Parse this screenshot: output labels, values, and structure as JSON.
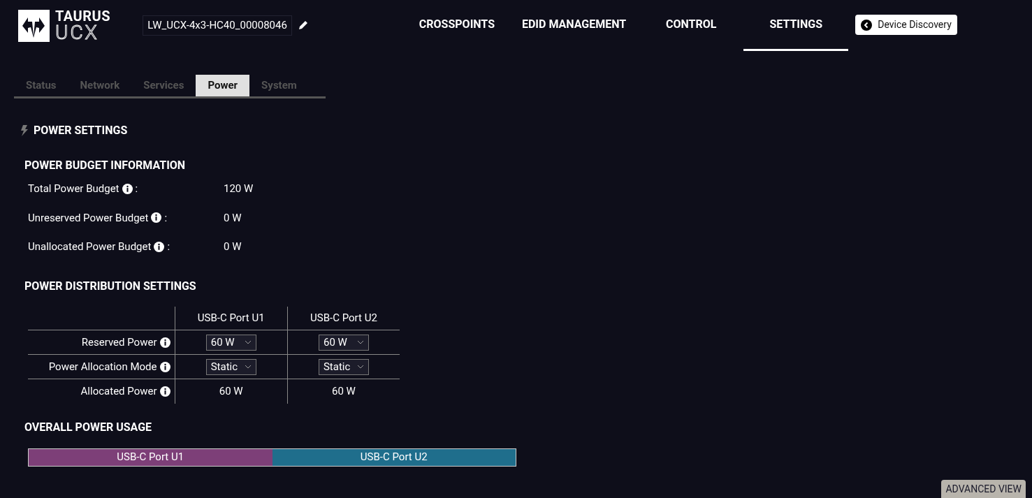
{
  "logo": {
    "line_1": "TAURUS",
    "line_2": "UCX"
  },
  "device_name": "LW_UCX-4x3-HC40_00008046",
  "nav": [
    {
      "label": "CROSSPOINTS",
      "selected": false
    },
    {
      "label": "EDID MANAGEMENT",
      "selected": false
    },
    {
      "label": "CONTROL",
      "selected": false
    },
    {
      "label": "SETTINGS",
      "selected": true
    }
  ],
  "device_discovery_button": "Device Discovery",
  "tabs": [
    {
      "label": "Status",
      "selected": false
    },
    {
      "label": "Network",
      "selected": false
    },
    {
      "label": "Services",
      "selected": false
    },
    {
      "label": "Power",
      "selected": true
    },
    {
      "label": "System",
      "selected": false
    }
  ],
  "section_title": "POWER SETTINGS",
  "budget": {
    "title": "POWER BUDGET INFORMATION",
    "rows": [
      {
        "label": "Total Power Budget",
        "suffix": ":",
        "value": "120 W"
      },
      {
        "label": "Unreserved Power Budget",
        "suffix": ":",
        "value": "0 W"
      },
      {
        "label": "Unallocated Power Budget",
        "suffix": ":",
        "value": "0 W"
      }
    ]
  },
  "distribution": {
    "title": "POWER DISTRIBUTION SETTINGS",
    "columns": [
      "USB-C Port U1",
      "USB-C Port U2"
    ],
    "rows": [
      {
        "label": "Reserved Power",
        "kind": "select",
        "cells": [
          "60 W",
          "60 W"
        ]
      },
      {
        "label": "Power Allocation Mode",
        "kind": "select",
        "cells": [
          "Static",
          "Static"
        ]
      },
      {
        "label": "Allocated Power",
        "kind": "text",
        "cells": [
          "60 W",
          "60 W"
        ]
      }
    ]
  },
  "usage": {
    "title": "OVERALL POWER USAGE",
    "segments": [
      {
        "label": "USB-C Port U1",
        "level": 0.5,
        "color": "#7d3f78"
      },
      {
        "label": "USB-C Port U2",
        "level": 0.5,
        "color": "#1f6e8c"
      }
    ]
  },
  "advanced_view_button": "ADVANCED VIEW"
}
